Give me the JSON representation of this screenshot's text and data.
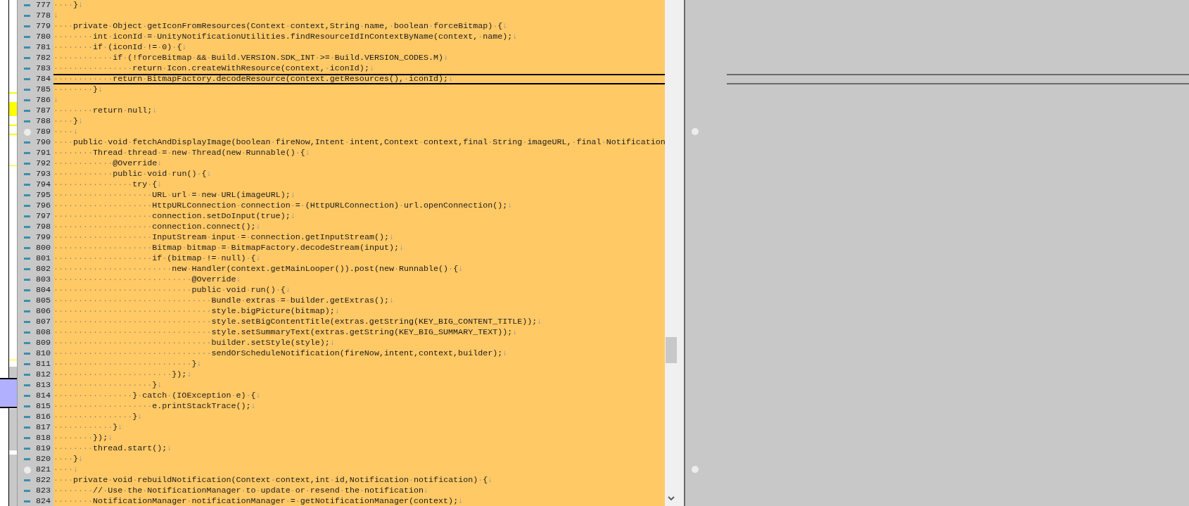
{
  "editor": {
    "lines": [
      {
        "number": "777",
        "kind": "dash",
        "current": false,
        "text": "····}",
        "eol": "↓"
      },
      {
        "number": "778",
        "kind": "dash",
        "current": false,
        "eol": "↓"
      },
      {
        "number": "779",
        "kind": "dash",
        "current": false,
        "text": "····private·Object·getIconFromResources(Context·context,String·name,·boolean·forceBitmap)·{",
        "eol": "↓"
      },
      {
        "number": "780",
        "kind": "dash",
        "current": false,
        "text": "········int·iconId·=·UnityNotificationUtilities.findResourceIdInContextByName(context,·name);",
        "eol": "↓"
      },
      {
        "number": "781",
        "kind": "dash",
        "current": false,
        "text": "········if·(iconId·!=·0)·{",
        "eol": "↓"
      },
      {
        "number": "782",
        "kind": "dash",
        "current": false,
        "text": "············if·(!forceBitmap·&&·Build.VERSION.SDK_INT·>=·Build.VERSION_CODES.M)",
        "eol": "↓"
      },
      {
        "number": "783",
        "kind": "dash",
        "current": false,
        "text": "················return·Icon.createWithResource(context,·iconId);",
        "eol": "↓"
      },
      {
        "number": "784",
        "kind": "dash",
        "current": true,
        "text": "············return·BitmapFactory.decodeResource(context.getResources(),·iconId);",
        "eol": "↓"
      },
      {
        "number": "785",
        "kind": "dash",
        "current": false,
        "text": "········}",
        "eol": "↓"
      },
      {
        "number": "786",
        "kind": "dash",
        "current": false,
        "eol": "↓"
      },
      {
        "number": "787",
        "kind": "dash",
        "current": false,
        "text": "········return·null;",
        "eol": "↓"
      },
      {
        "number": "788",
        "kind": "dash",
        "current": false,
        "text": "····}",
        "eol": "↓"
      },
      {
        "number": "789",
        "kind": "circle",
        "current": false,
        "text": "····",
        "eol": "↓"
      },
      {
        "number": "790",
        "kind": "dash",
        "current": false,
        "text": "····public·void·fetchAndDisplayImage(boolean·fireNow,Intent·intent,Context·context,final·String·imageURL,·final·Notification"
      },
      {
        "number": "791",
        "kind": "dash",
        "current": false,
        "text": "········Thread·thread·=·new·Thread(new·Runnable()·{",
        "eol": "↓"
      },
      {
        "number": "792",
        "kind": "dash",
        "current": false,
        "text": "············@Override",
        "eol": "↓"
      },
      {
        "number": "793",
        "kind": "dash",
        "current": false,
        "text": "············public·void·run()·{",
        "eol": "↓"
      },
      {
        "number": "794",
        "kind": "dash",
        "current": false,
        "text": "················try·{",
        "eol": "↓"
      },
      {
        "number": "795",
        "kind": "dash",
        "current": false,
        "text": "····················URL·url·=·new·URL(imageURL);",
        "eol": "↓"
      },
      {
        "number": "796",
        "kind": "dash",
        "current": false,
        "text": "····················HttpURLConnection·connection·=·(HttpURLConnection)·url.openConnection();",
        "eol": "↓"
      },
      {
        "number": "797",
        "kind": "dash",
        "current": false,
        "text": "····················connection.setDoInput(true);",
        "eol": "↓"
      },
      {
        "number": "798",
        "kind": "dash",
        "current": false,
        "text": "····················connection.connect();",
        "eol": "↓"
      },
      {
        "number": "799",
        "kind": "dash",
        "current": false,
        "text": "····················InputStream·input·=·connection.getInputStream();",
        "eol": "↓"
      },
      {
        "number": "800",
        "kind": "dash",
        "current": false,
        "text": "····················Bitmap·bitmap·=·BitmapFactory.decodeStream(input);",
        "eol": "↓"
      },
      {
        "number": "801",
        "kind": "dash",
        "current": false,
        "text": "····················if·(bitmap·!=·null)·{",
        "eol": "↓"
      },
      {
        "number": "802",
        "kind": "dash",
        "current": false,
        "text": "························new·Handler(context.getMainLooper()).post(new·Runnable()·{",
        "eol": "↓"
      },
      {
        "number": "803",
        "kind": "dash",
        "current": false,
        "text": "····························@Override",
        "eol": "↓"
      },
      {
        "number": "804",
        "kind": "dash",
        "current": false,
        "text": "····························public·void·run()·{",
        "eol": "↓"
      },
      {
        "number": "805",
        "kind": "dash",
        "current": false,
        "text": "································Bundle·extras·=·builder.getExtras();",
        "eol": "↓"
      },
      {
        "number": "806",
        "kind": "dash",
        "current": false,
        "text": "································style.bigPicture(bitmap);",
        "eol": "↓"
      },
      {
        "number": "807",
        "kind": "dash",
        "current": false,
        "text": "································style.setBigContentTitle(extras.getString(KEY_BIG_CONTENT_TITLE));",
        "eol": "↓"
      },
      {
        "number": "808",
        "kind": "dash",
        "current": false,
        "text": "································style.setSummaryText(extras.getString(KEY_BIG_SUMMARY_TEXT));",
        "eol": "↓"
      },
      {
        "number": "809",
        "kind": "dash",
        "current": false,
        "text": "································builder.setStyle(style);",
        "eol": "↓"
      },
      {
        "number": "810",
        "kind": "dash",
        "current": false,
        "text": "································sendOrScheduleNotification(fireNow,intent,context,builder);",
        "eol": "↓"
      },
      {
        "number": "811",
        "kind": "dash",
        "current": false,
        "text": "····························}",
        "eol": "↓"
      },
      {
        "number": "812",
        "kind": "dash",
        "current": false,
        "text": "························});",
        "eol": "↓"
      },
      {
        "number": "813",
        "kind": "dash",
        "current": false,
        "text": "····················}",
        "eol": "↓"
      },
      {
        "number": "814",
        "kind": "dash",
        "current": false,
        "text": "················}·catch·(IOException·e)·{",
        "eol": "↓"
      },
      {
        "number": "815",
        "kind": "dash",
        "current": false,
        "text": "····················e.printStackTrace();",
        "eol": "↓"
      },
      {
        "number": "816",
        "kind": "dash",
        "current": false,
        "text": "················}",
        "eol": "↓"
      },
      {
        "number": "817",
        "kind": "dash",
        "current": false,
        "text": "············}",
        "eol": "↓"
      },
      {
        "number": "818",
        "kind": "dash",
        "current": false,
        "text": "········});",
        "eol": "↓"
      },
      {
        "number": "819",
        "kind": "dash",
        "current": false,
        "text": "········thread.start();",
        "eol": "↓"
      },
      {
        "number": "820",
        "kind": "dash",
        "current": false,
        "text": "····}",
        "eol": "↓"
      },
      {
        "number": "821",
        "kind": "circle",
        "current": false,
        "text": "····",
        "eol": "↓"
      },
      {
        "number": "822",
        "kind": "dash",
        "current": false,
        "text": "····private·void·rebuildNotification(Context·context,int·id,Notification·notification)·{",
        "eol": "↓"
      },
      {
        "number": "823",
        "kind": "dash",
        "current": false,
        "text": "········//·Use·the·NotificationManager·to·update·or·resend·the·notification",
        "eol": "↓"
      },
      {
        "number": "824",
        "kind": "dash",
        "current": false,
        "text": "········NotificationManager·notificationManager·=·getNotificationManager(context);",
        "eol": "↓"
      }
    ]
  }
}
